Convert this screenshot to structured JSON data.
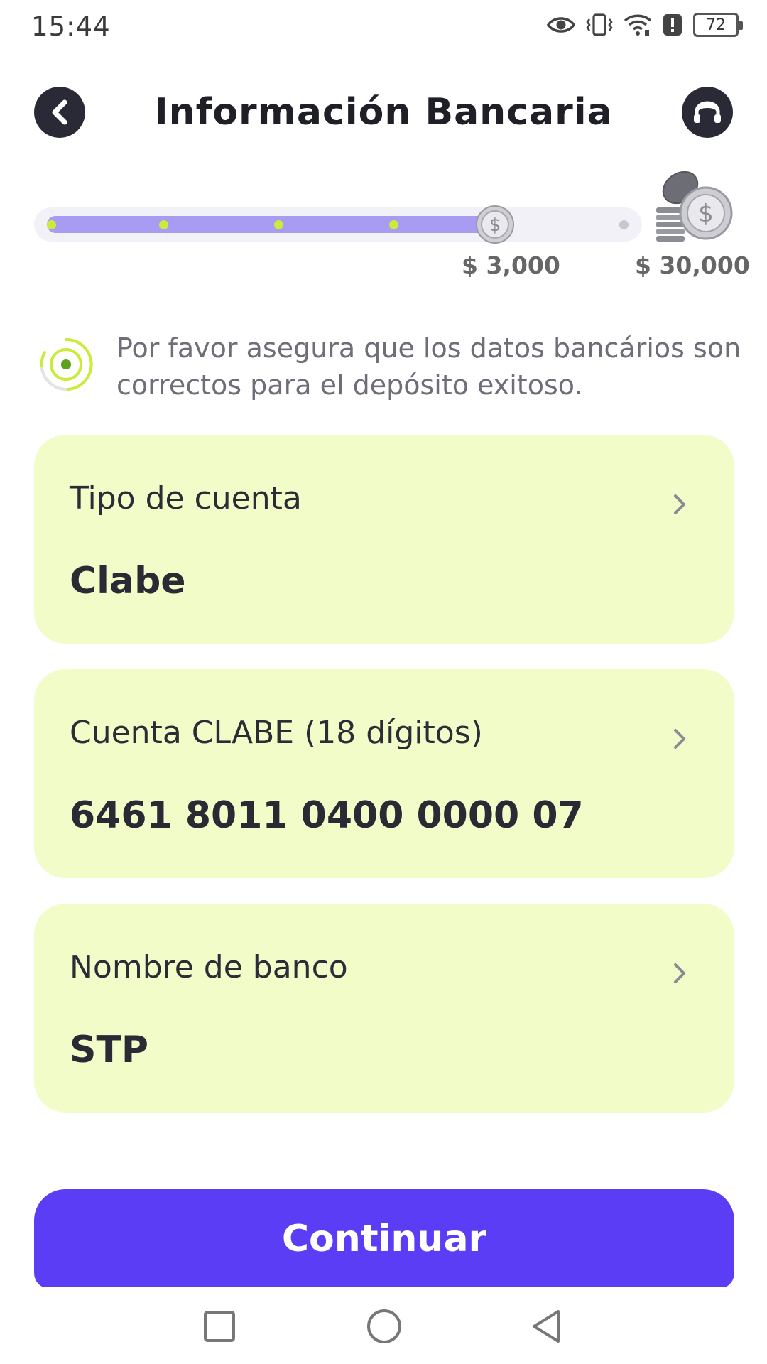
{
  "status_bar": {
    "time": "15:44",
    "icons": [
      "eye-icon",
      "vibrate-icon",
      "wifi-icon",
      "alert-icon",
      "battery-icon"
    ],
    "battery": "72"
  },
  "header": {
    "title": "Información Bancaria",
    "back_icon": "chevron-left-icon",
    "support_icon": "headset-icon"
  },
  "progress": {
    "current_label": "$ 3,000",
    "max_label": "$ 30,000",
    "current_value": 3000,
    "max_value": 30000,
    "fill_fraction": 0.77,
    "colors": {
      "fill": "#a79cf2",
      "dot": "#c9ec3a",
      "track": "#f2f1f8"
    }
  },
  "notice": {
    "icon": "target-icon",
    "text": "Por favor asegura que los datos bancários son correctos para el depósito exitoso."
  },
  "fields": [
    {
      "label": "Tipo de cuenta",
      "value": "Clabe"
    },
    {
      "label": "Cuenta CLABE (18 dígitos)",
      "value": "6461 8011 0400 0000 07"
    },
    {
      "label": "Nombre de banco",
      "value": "STP"
    }
  ],
  "actions": {
    "continue_label": "Continuar",
    "continue_color": "#5a3df5"
  },
  "nav_bar": {
    "icons": [
      "recent-apps-icon",
      "home-icon",
      "back-icon"
    ]
  },
  "colors": {
    "card_background": "#f1fcc9",
    "dark": "#2a2a36"
  }
}
